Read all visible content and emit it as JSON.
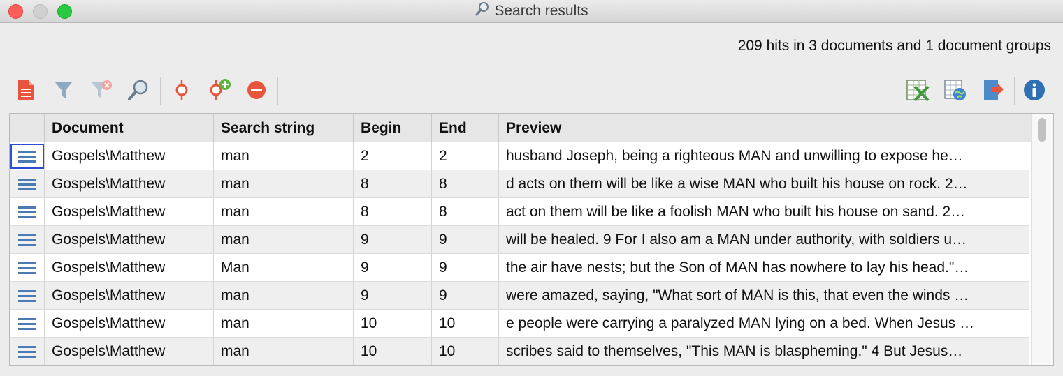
{
  "window": {
    "title": "Search results"
  },
  "summary": "209 hits in 3 documents and 1 document groups",
  "toolbar": {
    "left_tools": [
      {
        "name": "document-list-icon"
      },
      {
        "name": "filter-icon"
      },
      {
        "name": "remove-filter-icon"
      },
      {
        "name": "search-icon"
      },
      {
        "name": "code-icon"
      },
      {
        "name": "add-code-icon"
      },
      {
        "name": "remove-icon"
      }
    ],
    "right_tools": [
      {
        "name": "excel-export-icon"
      },
      {
        "name": "html-export-icon"
      },
      {
        "name": "export-icon"
      },
      {
        "name": "info-icon"
      }
    ]
  },
  "table": {
    "columns": [
      "",
      "Document",
      "Search string",
      "Begin",
      "End",
      "Preview"
    ],
    "rows": [
      {
        "document": "Gospels\\Matthew",
        "search": "man",
        "begin": "2",
        "end": "2",
        "preview": " husband Joseph, being a righteous MAN and unwilling to expose he…",
        "selected": true
      },
      {
        "document": "Gospels\\Matthew",
        "search": "man",
        "begin": "8",
        "end": "8",
        "preview": "d acts on them will be like a wise MAN who built his house on rock. 2…"
      },
      {
        "document": "Gospels\\Matthew",
        "search": "man",
        "begin": "8",
        "end": "8",
        "preview": "act on them will be like a foolish MAN who built his house on sand. 2…"
      },
      {
        "document": "Gospels\\Matthew",
        "search": "man",
        "begin": "9",
        "end": "9",
        "preview": " will be healed. 9 For I also am a MAN under authority, with soldiers u…"
      },
      {
        "document": "Gospels\\Matthew",
        "search": "Man",
        "begin": "9",
        "end": "9",
        "preview": "the air have nests; but the Son of MAN has nowhere to lay his head.\"…"
      },
      {
        "document": "Gospels\\Matthew",
        "search": "man",
        "begin": "9",
        "end": "9",
        "preview": "were amazed, saying, \"What sort of MAN is this, that even the winds …"
      },
      {
        "document": "Gospels\\Matthew",
        "search": "man",
        "begin": "10",
        "end": "10",
        "preview": "e people were carrying a paralyzed MAN lying on a bed. When Jesus …"
      },
      {
        "document": "Gospels\\Matthew",
        "search": "man",
        "begin": "10",
        "end": "10",
        "preview": " scribes said to themselves, \"This MAN is blaspheming.\" 4 But Jesus…"
      }
    ]
  },
  "colors": {
    "selection": "#2c4dd1",
    "row_icon": "#4a7bb3",
    "accent_red": "#e8553f"
  }
}
